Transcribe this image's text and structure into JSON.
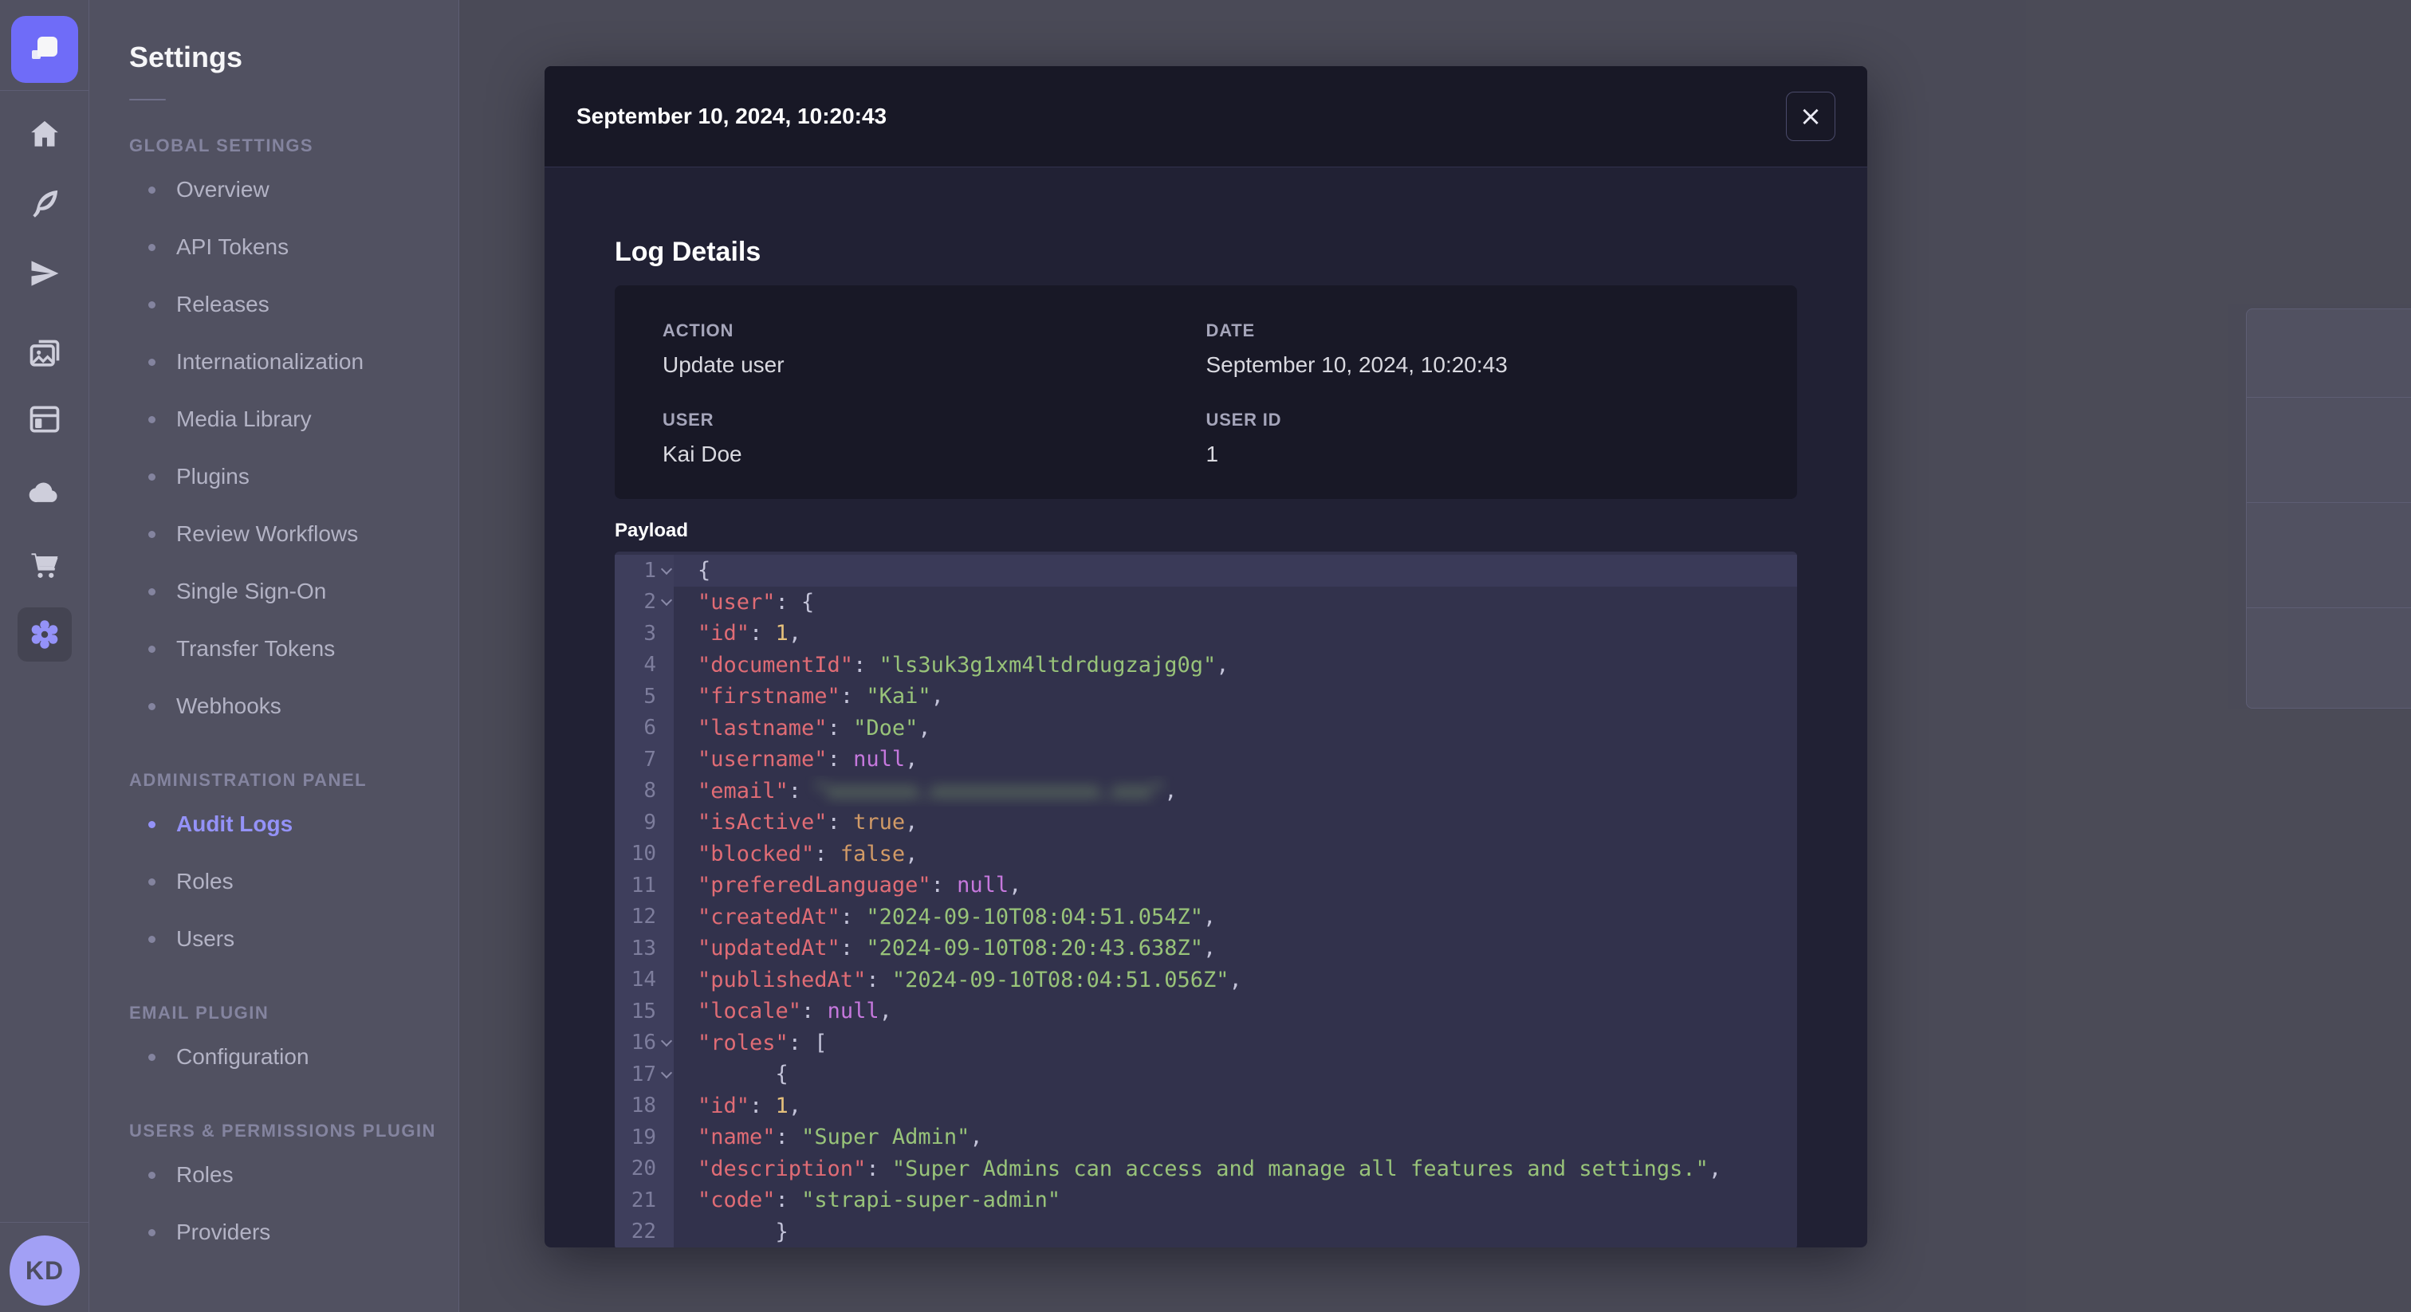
{
  "brand": {
    "accent": "#4945ff",
    "accent_light": "#7b79ff"
  },
  "icon_rail": {
    "logo_icon": "strapi-logo-icon",
    "items": [
      {
        "icon": "home-icon",
        "active": false
      },
      {
        "icon": "feather-icon",
        "active": false
      },
      {
        "icon": "paper-plane-icon",
        "active": false
      },
      {
        "icon": "media-images-icon",
        "active": false
      },
      {
        "icon": "layout-icon",
        "active": false
      },
      {
        "icon": "cloud-icon",
        "active": false
      },
      {
        "icon": "cart-icon",
        "active": false
      },
      {
        "icon": "gear-icon",
        "active": true
      }
    ],
    "avatar_initials": "KD"
  },
  "settings_nav": {
    "title": "Settings",
    "sections": [
      {
        "heading": "GLOBAL SETTINGS",
        "items": [
          "Overview",
          "API Tokens",
          "Releases",
          "Internationalization",
          "Media Library",
          "Plugins",
          "Review Workflows",
          "Single Sign-On",
          "Transfer Tokens",
          "Webhooks"
        ]
      },
      {
        "heading": "ADMINISTRATION PANEL",
        "items": [
          "Audit Logs",
          "Roles",
          "Users"
        ],
        "active_item": "Audit Logs"
      },
      {
        "heading": "EMAIL PLUGIN",
        "items": [
          "Configuration"
        ]
      },
      {
        "heading": "USERS & PERMISSIONS PLUGIN",
        "items": [
          "Roles",
          "Providers"
        ]
      }
    ]
  },
  "background_list": {
    "visible_rows": 3,
    "row_action_icon": "eye-icon"
  },
  "help_button": {
    "icon": "question-mark-icon",
    "glyph": "?"
  },
  "modal": {
    "title": "September 10, 2024, 10:20:43",
    "close_icon": "close-icon",
    "close_glyph": "×",
    "section_title": "Log Details",
    "details": {
      "action_label": "ACTION",
      "action_value": "Update user",
      "date_label": "DATE",
      "date_value": "September 10, 2024, 10:20:43",
      "user_label": "USER",
      "user_value": "Kai Doe",
      "userid_label": "USER ID",
      "userid_value": "1"
    },
    "payload_label": "Payload",
    "payload": {
      "active_line": 1,
      "fold_lines": [
        1,
        2,
        16,
        17
      ],
      "blurred_value_line": 8,
      "lines": [
        "{",
        "  \"user\": {",
        "    \"id\": 1,",
        "    \"documentId\": \"ls3uk3g1xm4ltdrdugzajg0g\",",
        "    \"firstname\": \"Kai\",",
        "    \"lastname\": \"Doe\",",
        "    \"username\": null,",
        "    \"email\": \"xxxxxxx.xxxxxxxxxxxxx.xxx\",",
        "    \"isActive\": true,",
        "    \"blocked\": false,",
        "    \"preferedLanguage\": null,",
        "    \"createdAt\": \"2024-09-10T08:04:51.054Z\",",
        "    \"updatedAt\": \"2024-09-10T08:20:43.638Z\",",
        "    \"publishedAt\": \"2024-09-10T08:04:51.056Z\",",
        "    \"locale\": null,",
        "    \"roles\": [",
        "      {",
        "        \"id\": 1,",
        "        \"name\": \"Super Admin\",",
        "        \"description\": \"Super Admins can access and manage all features and settings.\",",
        "        \"code\": \"strapi-super-admin\"",
        "      }",
        "    ]"
      ]
    }
  },
  "syntax_colors": {
    "key": "#e06c75",
    "string": "#98c379",
    "number": "#e5c07b",
    "boolean": "#d19a66",
    "null": "#c678dd",
    "punctuation": "#c3c3d9",
    "line_number": "#7d7d9c"
  }
}
